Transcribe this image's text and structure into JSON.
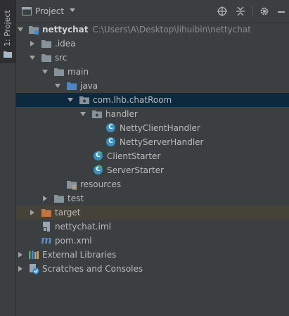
{
  "side_tab": {
    "label": "1: Project",
    "icon": "folder-icon"
  },
  "header": {
    "title": "Project",
    "dropdown_icon": "chevron-down-icon",
    "buttons": [
      "locate-icon",
      "collapse-all-icon",
      "gear-icon",
      "hide-icon"
    ]
  },
  "tree": [
    {
      "label": "nettychat",
      "path": "C:\\Users\\A\\Desktop\\lihuibin\\nettychat",
      "icon": "module-folder-icon",
      "expanded": true,
      "level": 0
    },
    {
      "label": ".idea",
      "icon": "folder-icon",
      "expanded": false,
      "level": 1
    },
    {
      "label": "src",
      "icon": "folder-icon",
      "expanded": true,
      "level": 1
    },
    {
      "label": "main",
      "icon": "folder-icon",
      "expanded": true,
      "level": 2
    },
    {
      "label": "java",
      "icon": "source-folder-icon",
      "expanded": true,
      "level": 3
    },
    {
      "label": "com.lhb.chatRoom",
      "icon": "package-icon",
      "expanded": true,
      "level": 4,
      "selected": true
    },
    {
      "label": "handler",
      "icon": "package-icon",
      "expanded": true,
      "level": 5
    },
    {
      "label": "NettyClientHandler",
      "icon": "class-icon",
      "level": 6
    },
    {
      "label": "NettyServerHandler",
      "icon": "class-icon",
      "level": 6
    },
    {
      "label": "ClientStarter",
      "icon": "runnable-class-icon",
      "level": 5
    },
    {
      "label": "ServerStarter",
      "icon": "runnable-class-icon",
      "level": 5
    },
    {
      "label": "resources",
      "icon": "resources-folder-icon",
      "level": 3
    },
    {
      "label": "test",
      "icon": "folder-icon",
      "expanded": false,
      "level": 2
    },
    {
      "label": "target",
      "icon": "excluded-folder-icon",
      "expanded": false,
      "level": 1,
      "highlighted": true
    },
    {
      "label": "nettychat.iml",
      "icon": "iml-file-icon",
      "level": 1
    },
    {
      "label": "pom.xml",
      "icon": "maven-icon",
      "level": 1
    },
    {
      "label": "External Libraries",
      "icon": "libraries-icon",
      "expanded": false,
      "level": 0
    },
    {
      "label": "Scratches and Consoles",
      "icon": "scratches-icon",
      "expanded": false,
      "level": 0
    }
  ],
  "colors": {
    "background": "#3c3f41",
    "selection": "#0d293e",
    "target_highlight": "#454239",
    "folder": "#87939a",
    "source_folder": "#4a86c8",
    "excluded_folder": "#c6733d",
    "class": "#3592c4"
  }
}
